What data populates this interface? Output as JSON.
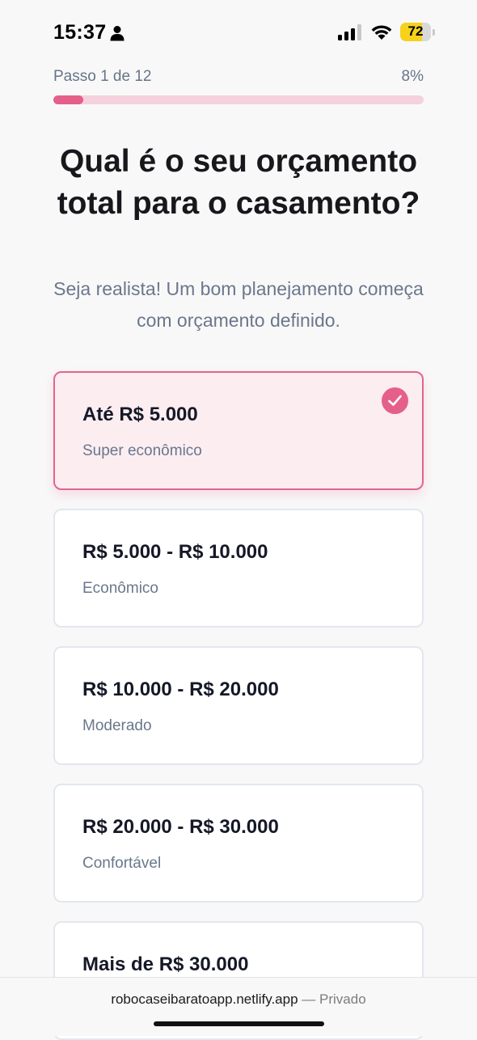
{
  "status_bar": {
    "time": "15:37",
    "battery_level": "72",
    "battery_fraction": 0.72,
    "icons": [
      "person-icon",
      "signal-icon",
      "wifi-icon",
      "battery-icon"
    ]
  },
  "progress": {
    "step_label": "Passo 1 de 12",
    "percent_label": "8%",
    "fraction": 0.08
  },
  "question": {
    "title": "Qual é o seu orçamento total para o casamento?",
    "subtitle": "Seja realista! Um bom planejamento começa com orçamento definido."
  },
  "options": [
    {
      "label": "Até R$ 5.000",
      "description": "Super econômico",
      "selected": true
    },
    {
      "label": "R$ 5.000 - R$ 10.000",
      "description": "Econômico",
      "selected": false
    },
    {
      "label": "R$ 10.000 - R$ 20.000",
      "description": "Moderado",
      "selected": false
    },
    {
      "label": "R$ 20.000 - R$ 30.000",
      "description": "Confortável",
      "selected": false
    },
    {
      "label": "Mais de R$ 30.000",
      "description": "",
      "selected": false
    }
  ],
  "browser": {
    "url": "robocaseibaratoapp.netlify.app",
    "mode": "— Privado"
  },
  "colors": {
    "accent": "#e55f8b",
    "progress_track": "#f5d1dd",
    "selected_bg": "#fcedf1",
    "muted_text": "#6a778c"
  }
}
